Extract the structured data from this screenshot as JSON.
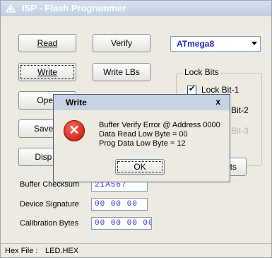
{
  "window": {
    "title": "ISP - Flash Programmer"
  },
  "buttons": {
    "read": "Read",
    "verify": "Verify",
    "write": "Write",
    "write_lbs": "Write LBs",
    "open": "Open",
    "save": "Save F",
    "disp": "Disp B",
    "bits": "Bits"
  },
  "device_select": {
    "value": "ATmega8"
  },
  "lock_bits": {
    "title": "Lock Bits",
    "items": [
      {
        "label": "Lock Bit-1",
        "checked": true
      },
      {
        "label": "Bit-2"
      },
      {
        "label": "Bit-3"
      }
    ]
  },
  "fields": {
    "buffer_checksum": {
      "label": "Buffer Checksum",
      "value": "21A567"
    },
    "device_signature": {
      "label": "Device Signature",
      "value": "00 00 00"
    },
    "calibration_bytes": {
      "label": "Calibration Bytes",
      "value": "00 00 00 00"
    }
  },
  "status": {
    "label": "Hex File :",
    "value": "LED.HEX"
  },
  "dialog": {
    "title": "Write",
    "close": "x",
    "lines": [
      "Buffer Verify Error @ Address  0000",
      "Data Read Low Byte  = 00",
      "Prog Data Low Byte  = 12"
    ],
    "ok": "OK"
  }
}
